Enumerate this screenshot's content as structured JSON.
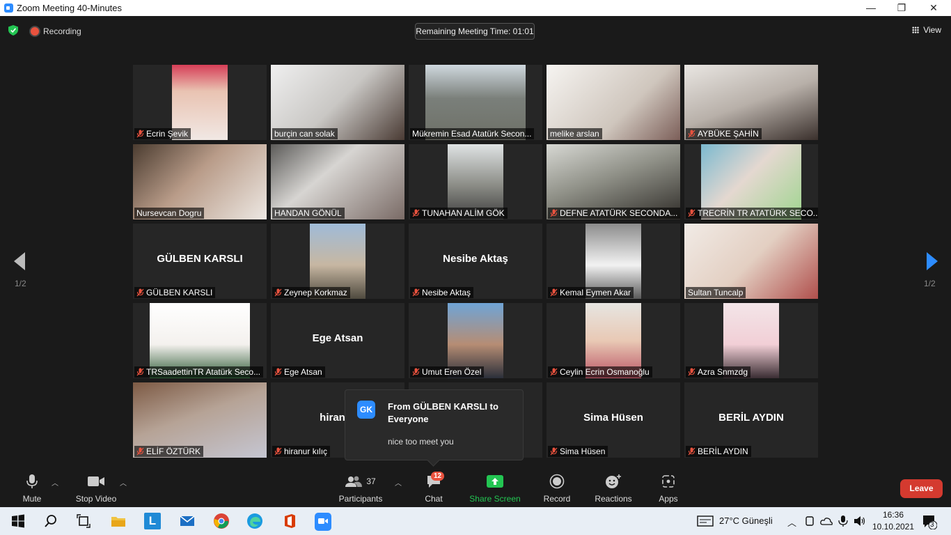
{
  "window": {
    "title": "Zoom Meeting 40-Minutes",
    "minimize": "—",
    "maximize": "❐",
    "close": "✕"
  },
  "topbar": {
    "recording_label": "Recording",
    "timer_label": "Remaining Meeting Time: 01:01",
    "view_label": "View"
  },
  "pagination": {
    "left_page": "1/2",
    "right_page": "1/2"
  },
  "participants": [
    {
      "name": "Ecrin Şevik",
      "muted": true,
      "video": true
    },
    {
      "name": "burçin can solak",
      "muted": false,
      "video": true
    },
    {
      "name": "Mükremin Esad Atatürk Secon...",
      "muted": false,
      "video": true
    },
    {
      "name": "melike arslan",
      "muted": false,
      "video": true
    },
    {
      "name": "AYBÜKE ŞAHİN",
      "muted": true,
      "video": true
    },
    {
      "name": "Nursevcan Dogru",
      "muted": false,
      "video": true,
      "active_speaker": true
    },
    {
      "name": "HANDAN GÖNÜL",
      "muted": false,
      "video": true
    },
    {
      "name": "TUNAHAN ALİM GÖK",
      "muted": true,
      "video": true
    },
    {
      "name": "DEFNE ATATÜRK SECONDA...",
      "muted": true,
      "video": true
    },
    {
      "name": "TRECRİN TR ATATÜRK SECO...",
      "muted": true,
      "video": true
    },
    {
      "name": "GÜLBEN KARSLI",
      "display_name": "GÜLBEN KARSLI",
      "muted": true,
      "video": false
    },
    {
      "name": "Zeynep Korkmaz",
      "muted": true,
      "video": true
    },
    {
      "name": "Nesibe Aktaş",
      "display_name": "Nesibe Aktaş",
      "muted": true,
      "video": false
    },
    {
      "name": "Kemal Eymen Akar",
      "muted": true,
      "video": true
    },
    {
      "name": "Sultan Tuncalp",
      "muted": false,
      "video": true
    },
    {
      "name": "TRSaadettinTR Atatürk Seco...",
      "muted": true,
      "video": true
    },
    {
      "name": "Ege Atsan",
      "display_name": "Ege Atsan",
      "muted": true,
      "video": false
    },
    {
      "name": "Umut Eren Özel",
      "muted": true,
      "video": true
    },
    {
      "name": "Ceylin Ecrin Osmanoğlu",
      "muted": true,
      "video": true
    },
    {
      "name": "Azra Snmzdg",
      "muted": true,
      "video": true
    },
    {
      "name": "ELİF ÖZTÜRK",
      "muted": true,
      "video": true
    },
    {
      "name": "hiranur kılıç",
      "display_name": "hiranur",
      "muted": true,
      "video": false
    },
    {
      "name": "",
      "muted": false,
      "video": false
    },
    {
      "name": "Sima Hüsen",
      "display_name": "Sima Hüsen",
      "muted": true,
      "video": false
    },
    {
      "name": "BERİL AYDIN",
      "display_name": "BERİL AYDIN",
      "muted": true,
      "video": false
    }
  ],
  "chat_popup": {
    "avatar_initials": "GK",
    "from": "From GÜLBEN KARSLI to Everyone",
    "message": "nice too meet you"
  },
  "toolbar": {
    "mute": "Mute",
    "stop_video": "Stop Video",
    "participants": "Participants",
    "participants_count": "37",
    "chat": "Chat",
    "chat_badge": "12",
    "share_screen": "Share Screen",
    "record": "Record",
    "reactions": "Reactions",
    "apps": "Apps",
    "leave": "Leave"
  },
  "taskbar": {
    "weather": "27°C  Güneşli",
    "time": "16:36",
    "date": "10.10.2021",
    "notifications": "3"
  },
  "colors": {
    "accent_blue": "#2d8cff",
    "share_green": "#23c552",
    "leave_red": "#d43a2f",
    "badge_red": "#e8523e",
    "active_outline": "#e8e88a"
  }
}
